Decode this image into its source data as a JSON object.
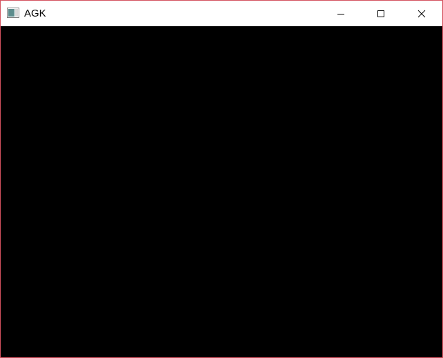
{
  "window": {
    "title": "AGK",
    "colors": {
      "border": "#d4525f",
      "titlebar": "#ffffff",
      "client": "#000000"
    },
    "icons": {
      "app": "app-window-icon",
      "minimize": "minimize-icon",
      "maximize": "maximize-icon",
      "close": "close-icon"
    }
  }
}
